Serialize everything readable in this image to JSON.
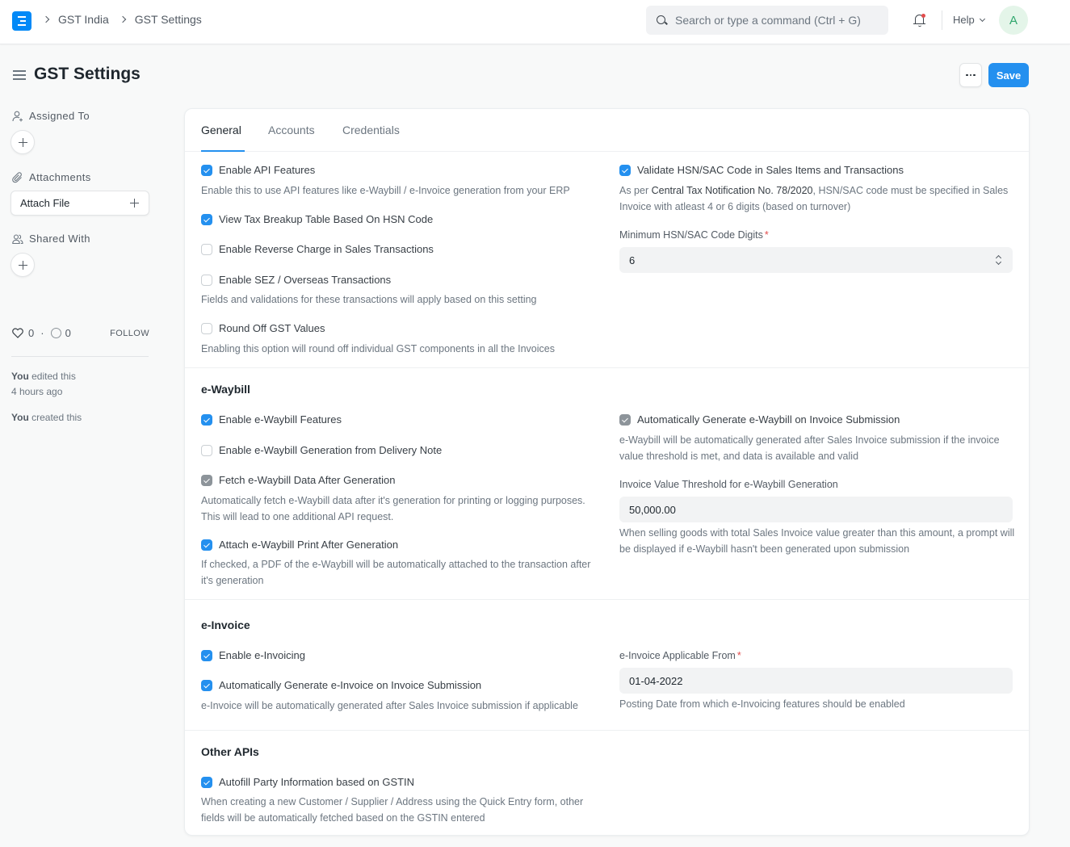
{
  "navbar": {
    "breadcrumbs": [
      "GST India",
      "GST Settings"
    ],
    "search_placeholder": "Search or type a command (Ctrl + G)",
    "help_label": "Help",
    "avatar_initial": "A",
    "notification_badge": true
  },
  "page": {
    "title": "GST Settings",
    "more_label": "...",
    "save_label": "Save"
  },
  "sidebar": {
    "assigned_to_label": "Assigned To",
    "attachments_label": "Attachments",
    "attach_file_label": "Attach File",
    "shared_with_label": "Shared With",
    "likes_count": "0",
    "comments_count": "0",
    "stats_separator": "·",
    "follow_label": "FOLLOW",
    "activity": [
      {
        "actor": "You",
        "action": "edited this",
        "time": "4 hours ago"
      },
      {
        "actor": "You",
        "action": "created this",
        "time": ""
      }
    ]
  },
  "tabs": [
    {
      "label": "General",
      "active": true
    },
    {
      "label": "Accounts",
      "active": false
    },
    {
      "label": "Credentials",
      "active": false
    }
  ],
  "general": {
    "enable_api": {
      "label": "Enable API Features",
      "checked": true,
      "description": "Enable this to use API features like e-Waybill / e-Invoice generation from your ERP"
    },
    "view_tax_breakup": {
      "label": "View Tax Breakup Table Based On HSN Code",
      "checked": true
    },
    "reverse_charge": {
      "label": "Enable Reverse Charge in Sales Transactions",
      "checked": false
    },
    "sez_overseas": {
      "label": "Enable SEZ / Overseas Transactions",
      "checked": false,
      "description": "Fields and validations for these transactions will apply based on this setting"
    },
    "round_off": {
      "label": "Round Off GST Values",
      "checked": false,
      "description": "Enabling this option will round off individual GST components in all the Invoices"
    },
    "validate_hsn": {
      "label": "Validate HSN/SAC Code in Sales Items and Transactions",
      "checked": true,
      "description_prefix": "As per ",
      "description_link": "Central Tax Notification No. 78/2020",
      "description_suffix": ", HSN/SAC code must be specified in Sales Invoice with atleast 4 or 6 digits (based on turnover)"
    },
    "min_hsn_digits": {
      "label": "Minimum HSN/SAC Code Digits",
      "required_mark": "*",
      "value": "6"
    }
  },
  "ewaybill": {
    "title": "e-Waybill",
    "enable_features": {
      "label": "Enable e-Waybill Features",
      "checked": true
    },
    "from_delivery_note": {
      "label": "Enable e-Waybill Generation from Delivery Note",
      "checked": false
    },
    "fetch_data": {
      "label": "Fetch e-Waybill Data After Generation",
      "checked": true,
      "disabled": true,
      "description": "Automatically fetch e-Waybill data after it's generation for printing or logging purposes. This will lead to one additional API request."
    },
    "attach_print": {
      "label": "Attach e-Waybill Print After Generation",
      "checked": true,
      "description": "If checked, a PDF of the e-Waybill will be automatically attached to the transaction after it's generation"
    },
    "auto_generate": {
      "label": "Automatically Generate e-Waybill on Invoice Submission",
      "checked": true,
      "disabled": true,
      "description": "e-Waybill will be automatically generated after Sales Invoice submission if the invoice value threshold is met, and data is available and valid"
    },
    "threshold": {
      "label": "Invoice Value Threshold for e-Waybill Generation",
      "value": "50,000.00",
      "description": "When selling goods with total Sales Invoice value greater than this amount, a prompt will be displayed if e-Waybill hasn't been generated upon submission"
    }
  },
  "einvoice": {
    "title": "e-Invoice",
    "enable": {
      "label": "Enable e-Invoicing",
      "checked": true
    },
    "auto_generate": {
      "label": "Automatically Generate e-Invoice on Invoice Submission",
      "checked": true,
      "description": "e-Invoice will be automatically generated after Sales Invoice submission if applicable"
    },
    "applicable_from": {
      "label": "e-Invoice Applicable From",
      "required_mark": "*",
      "value": "01-04-2022",
      "description": "Posting Date from which e-Invoicing features should be enabled"
    }
  },
  "other_apis": {
    "title": "Other APIs",
    "autofill": {
      "label": "Autofill Party Information based on GSTIN",
      "checked": true,
      "description": "When creating a new Customer / Supplier / Address using the Quick Entry form, other fields will be automatically fetched based on the GSTIN entered"
    }
  },
  "colors": {
    "accent": "#2490ef",
    "logo": "#0289f7",
    "checkbox_disabled": "#8d949a",
    "required": "#e24c4c",
    "avatar_bg": "#e4f5e9",
    "avatar_fg": "#30a66d"
  }
}
